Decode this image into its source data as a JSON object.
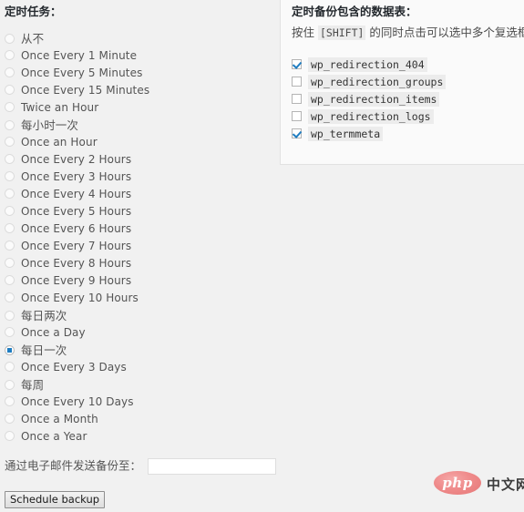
{
  "schedule": {
    "heading": "定时任务：",
    "options": [
      {
        "label": "从不",
        "cjk": true,
        "selected": false
      },
      {
        "label": "Once Every 1 Minute",
        "cjk": false,
        "selected": false
      },
      {
        "label": "Once Every 5 Minutes",
        "cjk": false,
        "selected": false
      },
      {
        "label": "Once Every 15 Minutes",
        "cjk": false,
        "selected": false
      },
      {
        "label": "Twice an Hour",
        "cjk": false,
        "selected": false
      },
      {
        "label": "每小时一次",
        "cjk": true,
        "selected": false
      },
      {
        "label": "Once an Hour",
        "cjk": false,
        "selected": false
      },
      {
        "label": "Once Every 2 Hours",
        "cjk": false,
        "selected": false
      },
      {
        "label": "Once Every 3 Hours",
        "cjk": false,
        "selected": false
      },
      {
        "label": "Once Every 4 Hours",
        "cjk": false,
        "selected": false
      },
      {
        "label": "Once Every 5 Hours",
        "cjk": false,
        "selected": false
      },
      {
        "label": "Once Every 6 Hours",
        "cjk": false,
        "selected": false
      },
      {
        "label": "Once Every 7 Hours",
        "cjk": false,
        "selected": false
      },
      {
        "label": "Once Every 8 Hours",
        "cjk": false,
        "selected": false
      },
      {
        "label": "Once Every 9 Hours",
        "cjk": false,
        "selected": false
      },
      {
        "label": "Once Every 10 Hours",
        "cjk": false,
        "selected": false
      },
      {
        "label": "每日两次",
        "cjk": true,
        "selected": false
      },
      {
        "label": "Once a Day",
        "cjk": false,
        "selected": false
      },
      {
        "label": "每日一次",
        "cjk": true,
        "selected": true
      },
      {
        "label": "Once Every 3 Days",
        "cjk": false,
        "selected": false
      },
      {
        "label": "每周",
        "cjk": true,
        "selected": false
      },
      {
        "label": "Once Every 10 Days",
        "cjk": false,
        "selected": false
      },
      {
        "label": "Once a Month",
        "cjk": false,
        "selected": false
      },
      {
        "label": "Once a Year",
        "cjk": false,
        "selected": false
      }
    ]
  },
  "email": {
    "label": "通过电子邮件发送备份至：",
    "value": "",
    "placeholder": ""
  },
  "submit": {
    "label": "Schedule backup"
  },
  "tables": {
    "heading": "定时备份包含的数据表：",
    "hint_before": "按住 ",
    "hint_key": "[SHIFT]",
    "hint_after": " 的同时点击可以选中多个复选框",
    "items": [
      {
        "name": "wp_redirection_404",
        "checked": true
      },
      {
        "name": "wp_redirection_groups",
        "checked": false
      },
      {
        "name": "wp_redirection_items",
        "checked": false
      },
      {
        "name": "wp_redirection_logs",
        "checked": false
      },
      {
        "name": "wp_termmeta",
        "checked": true
      }
    ]
  },
  "watermark": {
    "php": "php",
    "cn": "中文网",
    "color": "#e57777"
  },
  "colors": {
    "page_background": "#f1f1f1",
    "panel_background": "#fafafa",
    "accent": "#1f7dc1",
    "text": "#545454",
    "heading": "#23282d"
  }
}
